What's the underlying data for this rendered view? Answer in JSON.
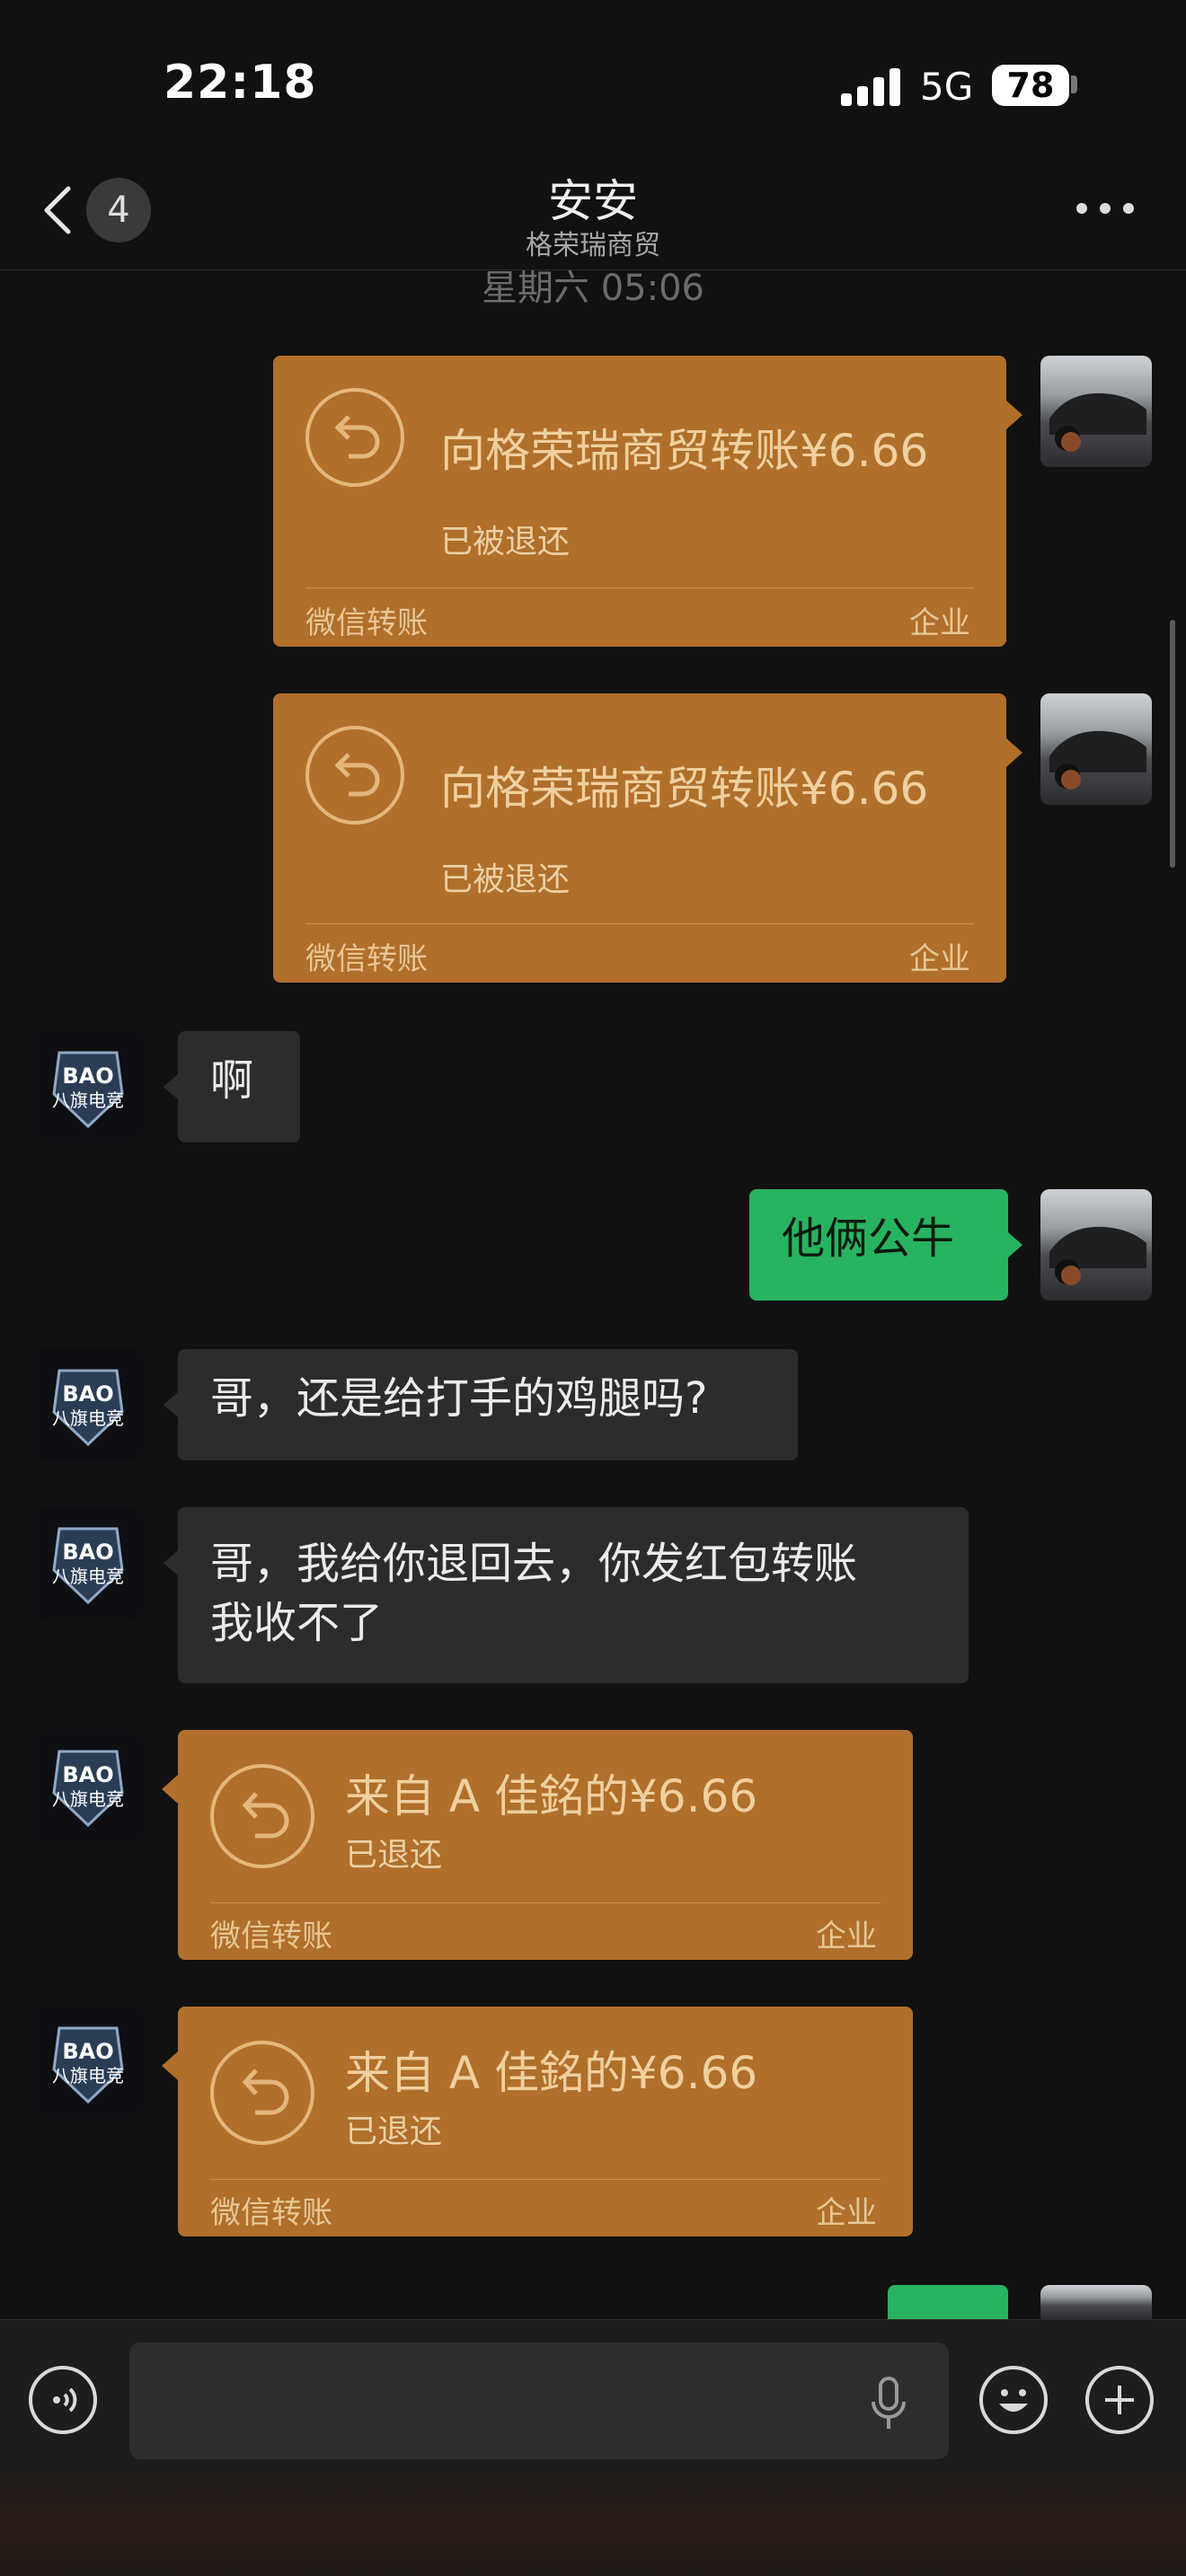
{
  "status_bar": {
    "time": "22:18",
    "network": "5G",
    "battery": "78"
  },
  "header": {
    "back_count": "4",
    "title": "安安",
    "subtitle": "格荣瑞商贸",
    "more_icon": "more-icon"
  },
  "timestamp": "星期六 05:06",
  "messages": {
    "m1": {
      "amount": "向格荣瑞商贸转账¥6.66",
      "status": "已被退还",
      "footer_left": "微信转账",
      "footer_right": "企业"
    },
    "m2": {
      "amount": "向格荣瑞商贸转账¥6.66",
      "status": "已被退还",
      "footer_left": "微信转账",
      "footer_right": "企业"
    },
    "m3": {
      "text": "啊"
    },
    "m4": {
      "text": "他俩公牛"
    },
    "m5": {
      "text": "哥，还是给打手的鸡腿吗?"
    },
    "m6": {
      "line1": "哥，我给你退回去，你发红包转账",
      "line2": "我收不了"
    },
    "m7": {
      "amount": "来自 A 佳銘的¥6.66",
      "status": "已退还",
      "footer_left": "微信转账",
      "footer_right": "企业"
    },
    "m8": {
      "amount": "来自 A 佳銘的¥6.66",
      "status": "已退还",
      "footer_left": "微信转账",
      "footer_right": "企业"
    }
  },
  "avatars": {
    "self": "car-photo",
    "contact": "logo",
    "logo_text": "BAO",
    "logo_sub": "八旗电竞"
  },
  "input_bar": {
    "voice_icon": "voice-icon",
    "mic_icon": "mic-icon",
    "emoji_icon": "emoji-icon",
    "plus_icon": "plus-icon"
  },
  "colors": {
    "background": "#111111",
    "transfer_card": "#b06f2a",
    "outgoing_bubble": "#28b360",
    "incoming_bubble": "#2c2c2c"
  }
}
